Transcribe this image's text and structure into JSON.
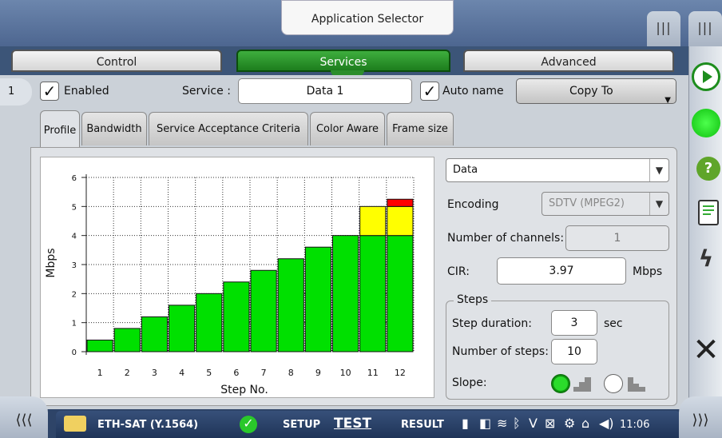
{
  "topbar": {
    "app_selector": "Application Selector",
    "grip_left": "|||",
    "grip_right": "|||"
  },
  "main_tabs": [
    {
      "label": "Control",
      "active": false
    },
    {
      "label": "Services",
      "active": true
    },
    {
      "label": "Advanced",
      "active": false
    }
  ],
  "service_row": {
    "index": "1",
    "enabled_label": "Enabled",
    "enabled_checked": true,
    "service_label": "Service :",
    "service_value": "Data 1",
    "autoname_label": "Auto name",
    "autoname_checked": true,
    "copy_to_label": "Copy To"
  },
  "sub_tabs": [
    {
      "label": "Profile",
      "active": true
    },
    {
      "label": "Bandwidth",
      "active": false
    },
    {
      "label": "Service Acceptance Criteria",
      "active": false
    },
    {
      "label": "Color Aware",
      "active": false
    },
    {
      "label": "Frame size",
      "active": false
    }
  ],
  "form": {
    "profile_type": "Data",
    "encoding_label": "Encoding",
    "encoding_value": "SDTV (MPEG2)",
    "channels_label": "Number of channels:",
    "channels_value": "1",
    "cir_label": "CIR:",
    "cir_value": "3.97",
    "cir_unit": "Mbps",
    "steps_title": "Steps",
    "step_duration_label": "Step duration:",
    "step_duration_value": "3",
    "step_duration_unit": "sec",
    "num_steps_label": "Number of steps:",
    "num_steps_value": "10",
    "slope_label": "Slope:"
  },
  "chart_data": {
    "type": "bar",
    "xlabel": "Step No.",
    "ylabel": "Mbps",
    "ylim": [
      0,
      6
    ],
    "yticks": [
      0,
      1,
      2,
      3,
      4,
      5,
      6
    ],
    "categories": [
      "1",
      "2",
      "3",
      "4",
      "5",
      "6",
      "7",
      "8",
      "9",
      "10",
      "11",
      "12"
    ],
    "series": [
      {
        "color": "#00e000",
        "values": [
          0.4,
          0.8,
          1.2,
          1.6,
          2.0,
          2.4,
          2.8,
          3.2,
          3.6,
          4.0,
          4.0,
          4.0
        ]
      },
      {
        "color": "#ffff00",
        "values": [
          0,
          0,
          0,
          0,
          0,
          0,
          0,
          0,
          0,
          0,
          1.0,
          1.0
        ]
      },
      {
        "color": "#ff0000",
        "values": [
          0,
          0,
          0,
          0,
          0,
          0,
          0,
          0,
          0,
          0,
          0,
          0.25
        ]
      }
    ],
    "grid": true
  },
  "statusbar": {
    "test_name": "ETH-SAT (Y.1564)",
    "setup": "SETUP",
    "test": "TEST",
    "result": "RESULT",
    "time": "11:06"
  },
  "colors": {
    "accent_green": "#1d8d1d",
    "topbar": "#5d77a0"
  }
}
